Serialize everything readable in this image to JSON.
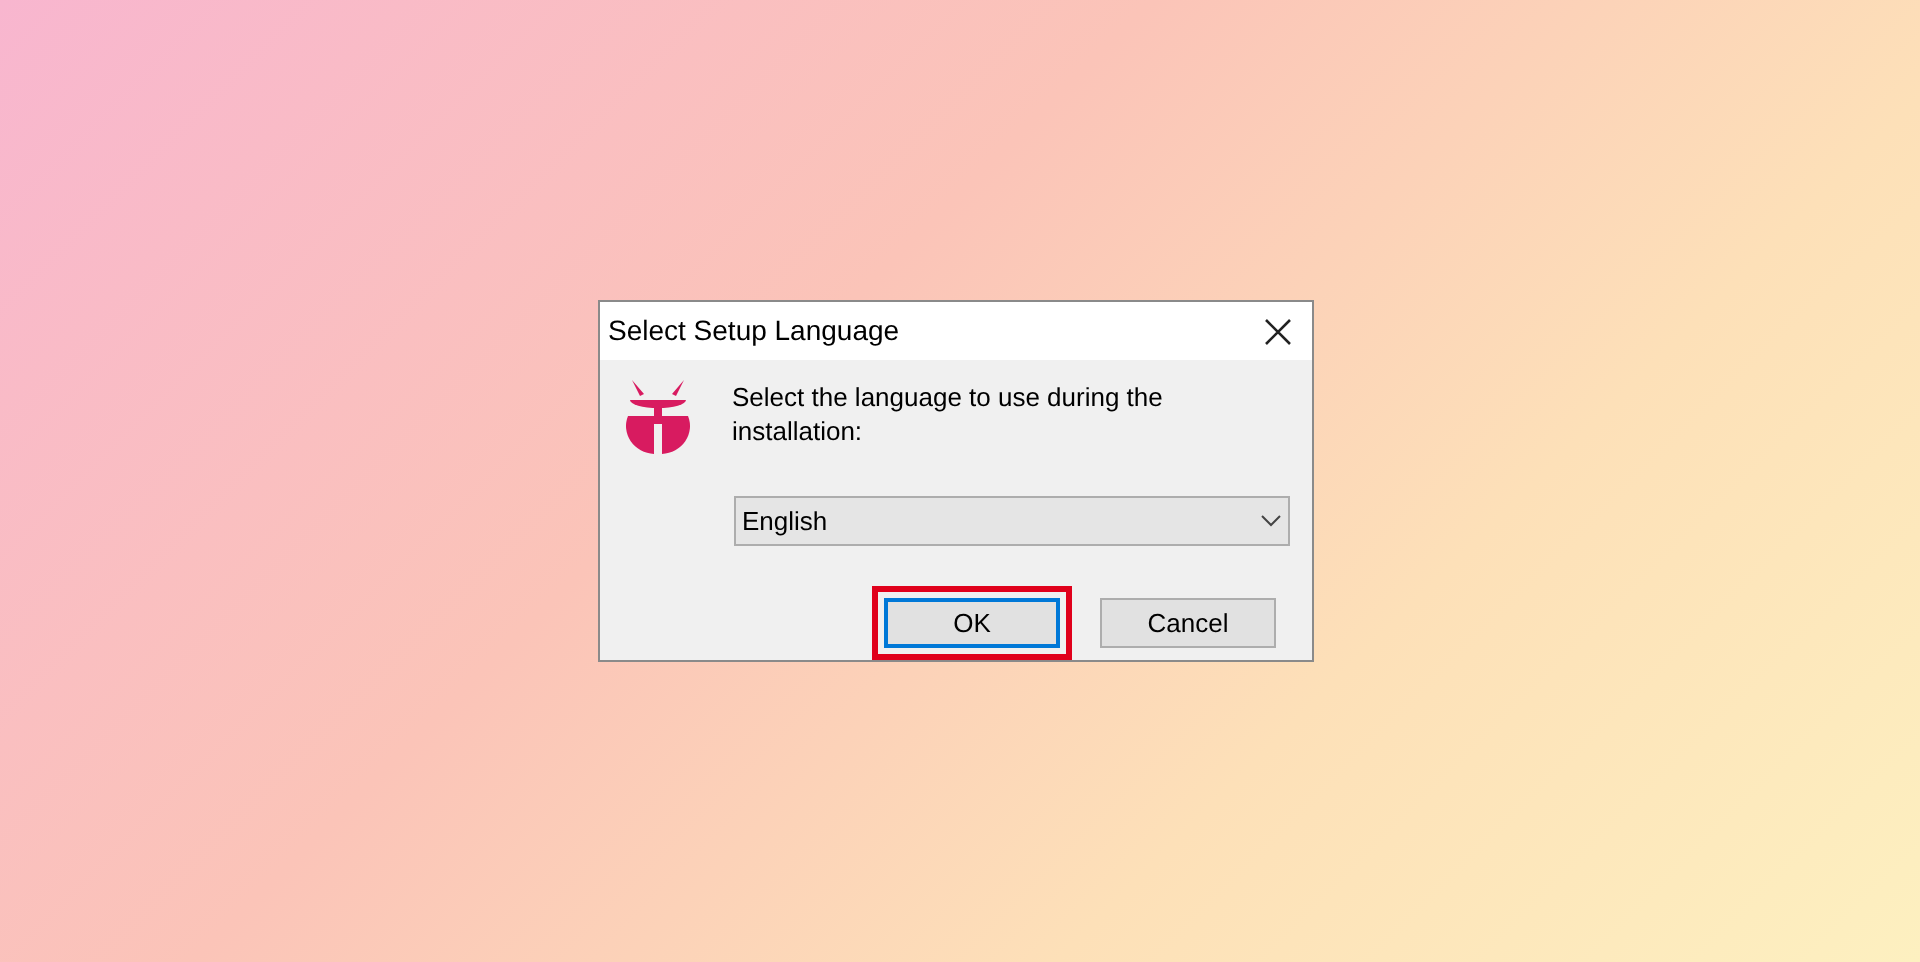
{
  "window": {
    "title": "Select Setup Language"
  },
  "prompt": "Select the language to use during the installation:",
  "language_dropdown": {
    "value": "English"
  },
  "buttons": [
    {
      "label": "OK",
      "default": true,
      "highlighted": true
    },
    {
      "label": "Cancel",
      "default": false,
      "highlighted": false
    }
  ]
}
